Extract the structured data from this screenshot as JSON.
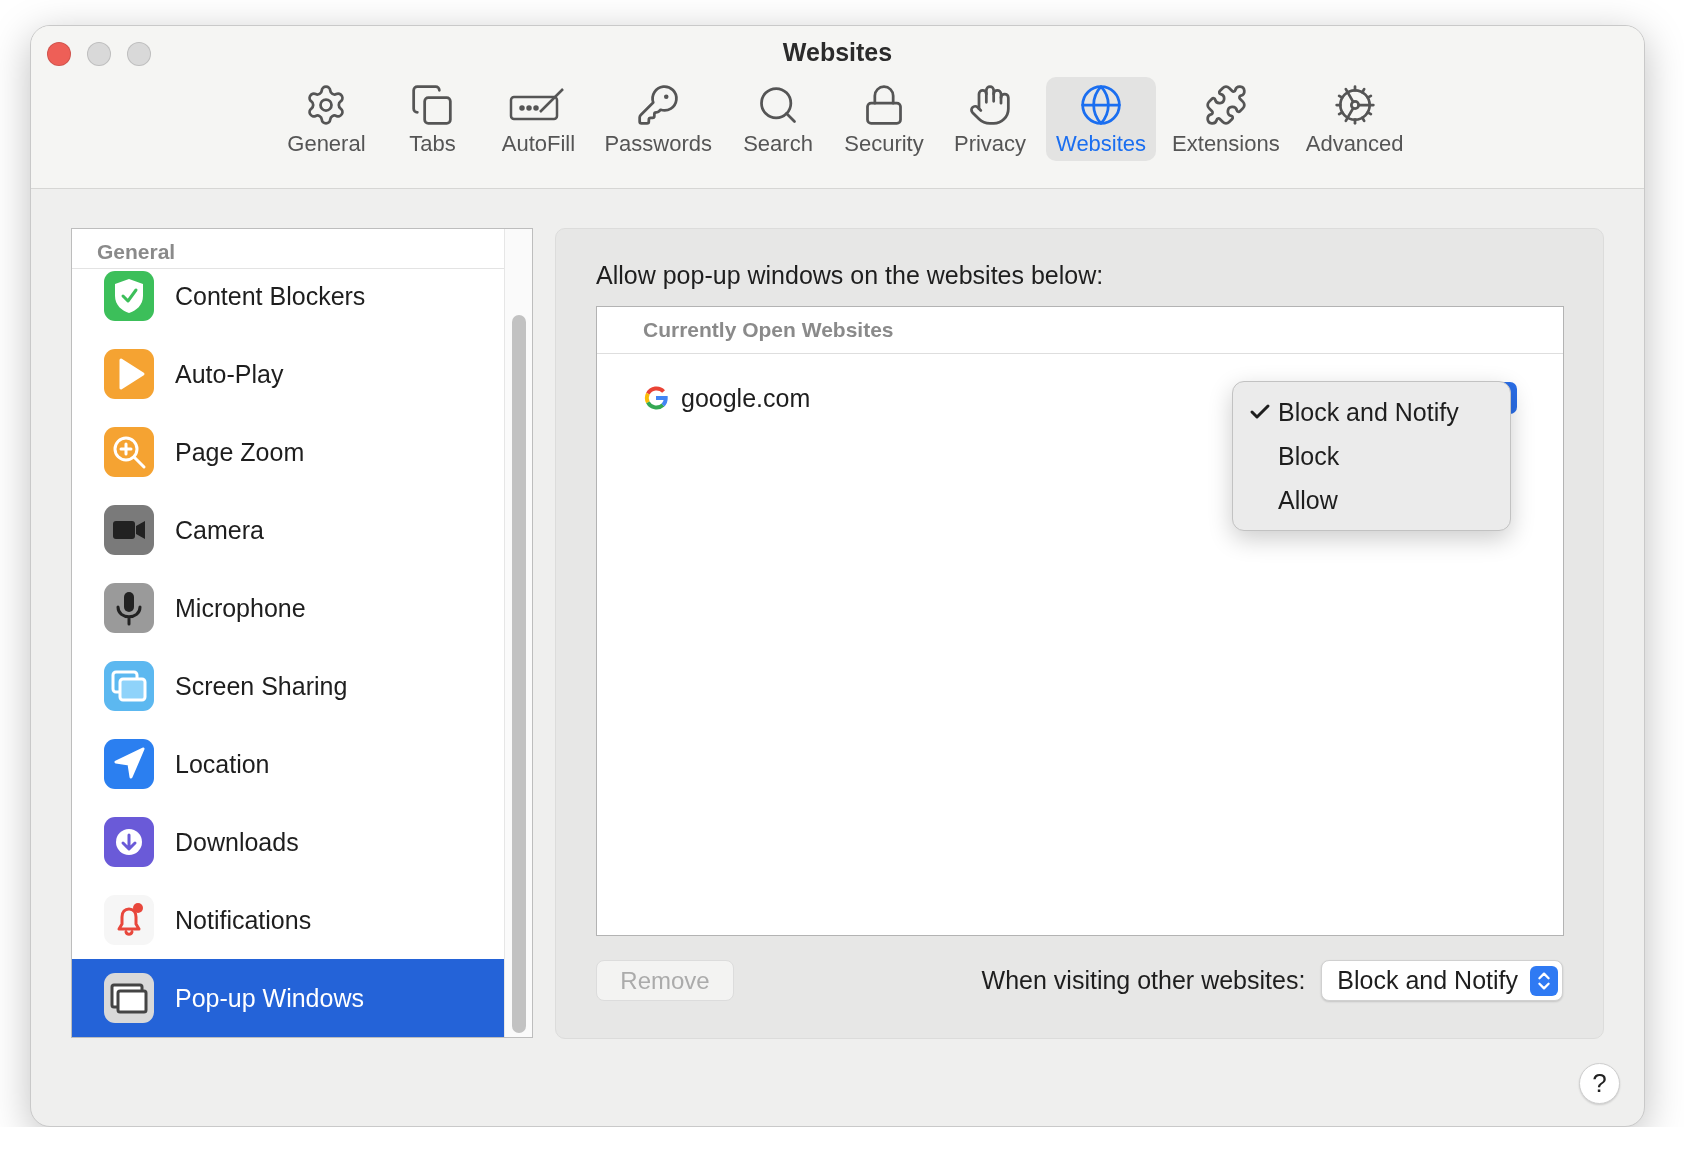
{
  "window": {
    "title": "Websites"
  },
  "toolbar": {
    "items": [
      {
        "label": "General",
        "kind": "gear",
        "selected": false
      },
      {
        "label": "Tabs",
        "kind": "tabs",
        "selected": false
      },
      {
        "label": "AutoFill",
        "kind": "autofill",
        "selected": false
      },
      {
        "label": "Passwords",
        "kind": "key",
        "selected": false
      },
      {
        "label": "Search",
        "kind": "search",
        "selected": false
      },
      {
        "label": "Security",
        "kind": "lock",
        "selected": false
      },
      {
        "label": "Privacy",
        "kind": "hand",
        "selected": false
      },
      {
        "label": "Websites",
        "kind": "globe",
        "selected": true
      },
      {
        "label": "Extensions",
        "kind": "puzzle",
        "selected": false
      },
      {
        "label": "Advanced",
        "kind": "gears",
        "selected": false
      }
    ]
  },
  "sidebar": {
    "header": "General",
    "items": [
      {
        "label": "Content Blockers",
        "kind": "shield",
        "selected": false
      },
      {
        "label": "Auto-Play",
        "kind": "play",
        "selected": false
      },
      {
        "label": "Page Zoom",
        "kind": "zoom",
        "selected": false
      },
      {
        "label": "Camera",
        "kind": "camera",
        "selected": false
      },
      {
        "label": "Microphone",
        "kind": "microphone",
        "selected": false
      },
      {
        "label": "Screen Sharing",
        "kind": "screens",
        "selected": false
      },
      {
        "label": "Location",
        "kind": "location",
        "selected": false
      },
      {
        "label": "Downloads",
        "kind": "download",
        "selected": false
      },
      {
        "label": "Notifications",
        "kind": "bell",
        "selected": false
      },
      {
        "label": "Pop-up Windows",
        "kind": "popup",
        "selected": true
      }
    ]
  },
  "panel": {
    "heading": "Allow pop-up windows on the websites below:",
    "table": {
      "column_header": "Currently Open Websites",
      "rows": [
        {
          "site": "google.com"
        }
      ]
    },
    "menu": {
      "items": [
        {
          "label": "Block and Notify",
          "checked": true
        },
        {
          "label": "Block",
          "checked": false
        },
        {
          "label": "Allow",
          "checked": false
        }
      ]
    },
    "remove_button": {
      "label": "Remove",
      "disabled": true
    },
    "default_label": "When visiting other websites:",
    "default_select": "Block and Notify"
  },
  "help_button": "?"
}
